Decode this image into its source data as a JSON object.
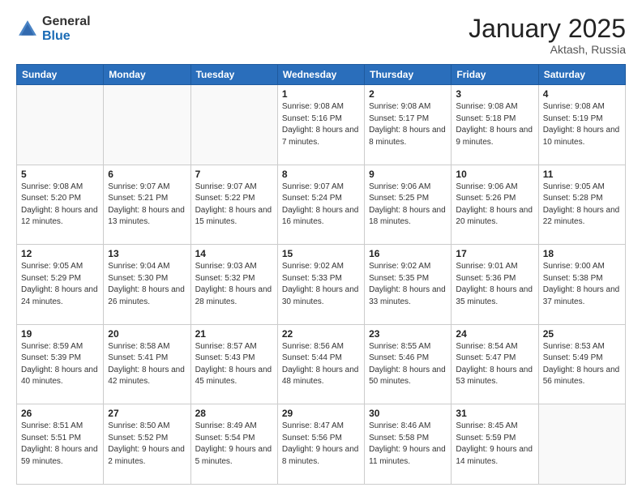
{
  "header": {
    "logo_general": "General",
    "logo_blue": "Blue",
    "month": "January 2025",
    "location": "Aktash, Russia"
  },
  "weekdays": [
    "Sunday",
    "Monday",
    "Tuesday",
    "Wednesday",
    "Thursday",
    "Friday",
    "Saturday"
  ],
  "weeks": [
    [
      {
        "day": "",
        "empty": true
      },
      {
        "day": "",
        "empty": true
      },
      {
        "day": "",
        "empty": true
      },
      {
        "day": "1",
        "sunrise": "9:08 AM",
        "sunset": "5:16 PM",
        "daylight": "8 hours and 7 minutes."
      },
      {
        "day": "2",
        "sunrise": "9:08 AM",
        "sunset": "5:17 PM",
        "daylight": "8 hours and 8 minutes."
      },
      {
        "day": "3",
        "sunrise": "9:08 AM",
        "sunset": "5:18 PM",
        "daylight": "8 hours and 9 minutes."
      },
      {
        "day": "4",
        "sunrise": "9:08 AM",
        "sunset": "5:19 PM",
        "daylight": "8 hours and 10 minutes."
      }
    ],
    [
      {
        "day": "5",
        "sunrise": "9:08 AM",
        "sunset": "5:20 PM",
        "daylight": "8 hours and 12 minutes."
      },
      {
        "day": "6",
        "sunrise": "9:07 AM",
        "sunset": "5:21 PM",
        "daylight": "8 hours and 13 minutes."
      },
      {
        "day": "7",
        "sunrise": "9:07 AM",
        "sunset": "5:22 PM",
        "daylight": "8 hours and 15 minutes."
      },
      {
        "day": "8",
        "sunrise": "9:07 AM",
        "sunset": "5:24 PM",
        "daylight": "8 hours and 16 minutes."
      },
      {
        "day": "9",
        "sunrise": "9:06 AM",
        "sunset": "5:25 PM",
        "daylight": "8 hours and 18 minutes."
      },
      {
        "day": "10",
        "sunrise": "9:06 AM",
        "sunset": "5:26 PM",
        "daylight": "8 hours and 20 minutes."
      },
      {
        "day": "11",
        "sunrise": "9:05 AM",
        "sunset": "5:28 PM",
        "daylight": "8 hours and 22 minutes."
      }
    ],
    [
      {
        "day": "12",
        "sunrise": "9:05 AM",
        "sunset": "5:29 PM",
        "daylight": "8 hours and 24 minutes."
      },
      {
        "day": "13",
        "sunrise": "9:04 AM",
        "sunset": "5:30 PM",
        "daylight": "8 hours and 26 minutes."
      },
      {
        "day": "14",
        "sunrise": "9:03 AM",
        "sunset": "5:32 PM",
        "daylight": "8 hours and 28 minutes."
      },
      {
        "day": "15",
        "sunrise": "9:02 AM",
        "sunset": "5:33 PM",
        "daylight": "8 hours and 30 minutes."
      },
      {
        "day": "16",
        "sunrise": "9:02 AM",
        "sunset": "5:35 PM",
        "daylight": "8 hours and 33 minutes."
      },
      {
        "day": "17",
        "sunrise": "9:01 AM",
        "sunset": "5:36 PM",
        "daylight": "8 hours and 35 minutes."
      },
      {
        "day": "18",
        "sunrise": "9:00 AM",
        "sunset": "5:38 PM",
        "daylight": "8 hours and 37 minutes."
      }
    ],
    [
      {
        "day": "19",
        "sunrise": "8:59 AM",
        "sunset": "5:39 PM",
        "daylight": "8 hours and 40 minutes."
      },
      {
        "day": "20",
        "sunrise": "8:58 AM",
        "sunset": "5:41 PM",
        "daylight": "8 hours and 42 minutes."
      },
      {
        "day": "21",
        "sunrise": "8:57 AM",
        "sunset": "5:43 PM",
        "daylight": "8 hours and 45 minutes."
      },
      {
        "day": "22",
        "sunrise": "8:56 AM",
        "sunset": "5:44 PM",
        "daylight": "8 hours and 48 minutes."
      },
      {
        "day": "23",
        "sunrise": "8:55 AM",
        "sunset": "5:46 PM",
        "daylight": "8 hours and 50 minutes."
      },
      {
        "day": "24",
        "sunrise": "8:54 AM",
        "sunset": "5:47 PM",
        "daylight": "8 hours and 53 minutes."
      },
      {
        "day": "25",
        "sunrise": "8:53 AM",
        "sunset": "5:49 PM",
        "daylight": "8 hours and 56 minutes."
      }
    ],
    [
      {
        "day": "26",
        "sunrise": "8:51 AM",
        "sunset": "5:51 PM",
        "daylight": "8 hours and 59 minutes."
      },
      {
        "day": "27",
        "sunrise": "8:50 AM",
        "sunset": "5:52 PM",
        "daylight": "9 hours and 2 minutes."
      },
      {
        "day": "28",
        "sunrise": "8:49 AM",
        "sunset": "5:54 PM",
        "daylight": "9 hours and 5 minutes."
      },
      {
        "day": "29",
        "sunrise": "8:47 AM",
        "sunset": "5:56 PM",
        "daylight": "9 hours and 8 minutes."
      },
      {
        "day": "30",
        "sunrise": "8:46 AM",
        "sunset": "5:58 PM",
        "daylight": "9 hours and 11 minutes."
      },
      {
        "day": "31",
        "sunrise": "8:45 AM",
        "sunset": "5:59 PM",
        "daylight": "9 hours and 14 minutes."
      },
      {
        "day": "",
        "empty": true
      }
    ]
  ]
}
